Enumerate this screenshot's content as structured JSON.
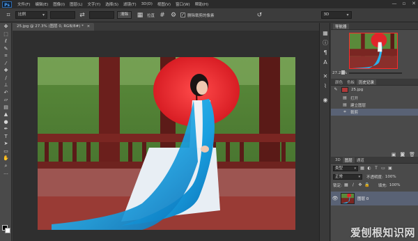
{
  "menubar": {
    "logo": "Ps",
    "items": [
      "文件(F)",
      "编辑(E)",
      "图像(I)",
      "图层(L)",
      "文字(Y)",
      "选择(S)",
      "滤镜(T)",
      "3D(D)",
      "视图(V)",
      "窗口(W)",
      "帮助(H)"
    ],
    "window_controls": [
      "—",
      "▫",
      "✕"
    ]
  },
  "options": {
    "ratio_select": "比例",
    "straighten_button": "拉直",
    "straighten_label": "拉直",
    "delete_cropped_label": "删除裁剪的像素",
    "workspace_select": "3D"
  },
  "document": {
    "tab_title": "25.jpg @ 27.3% (图层 0, RGB/8#) *",
    "tab_close": "×"
  },
  "navigator": {
    "tabs": [
      "导航器"
    ],
    "zoom": "27.25%"
  },
  "history": {
    "tabs": [
      "颜色",
      "色板",
      "历史记录"
    ],
    "snapshot": "25.jpg",
    "items": [
      "打开",
      "建立图层",
      "裁剪"
    ]
  },
  "layers": {
    "tabs": [
      "3D",
      "图层",
      "通道"
    ],
    "filter_select": "类型",
    "blend_select": "正常",
    "opacity_label": "不透明度:",
    "opacity_value": "100%",
    "lock_label": "锁定:",
    "fill_label": "填充:",
    "fill_value": "100%",
    "layer_name": "图层 0"
  },
  "watermark": "爱刨根知识网",
  "colors": {
    "accent_selected": "#596275",
    "crop_border": "#ff2a2a"
  }
}
